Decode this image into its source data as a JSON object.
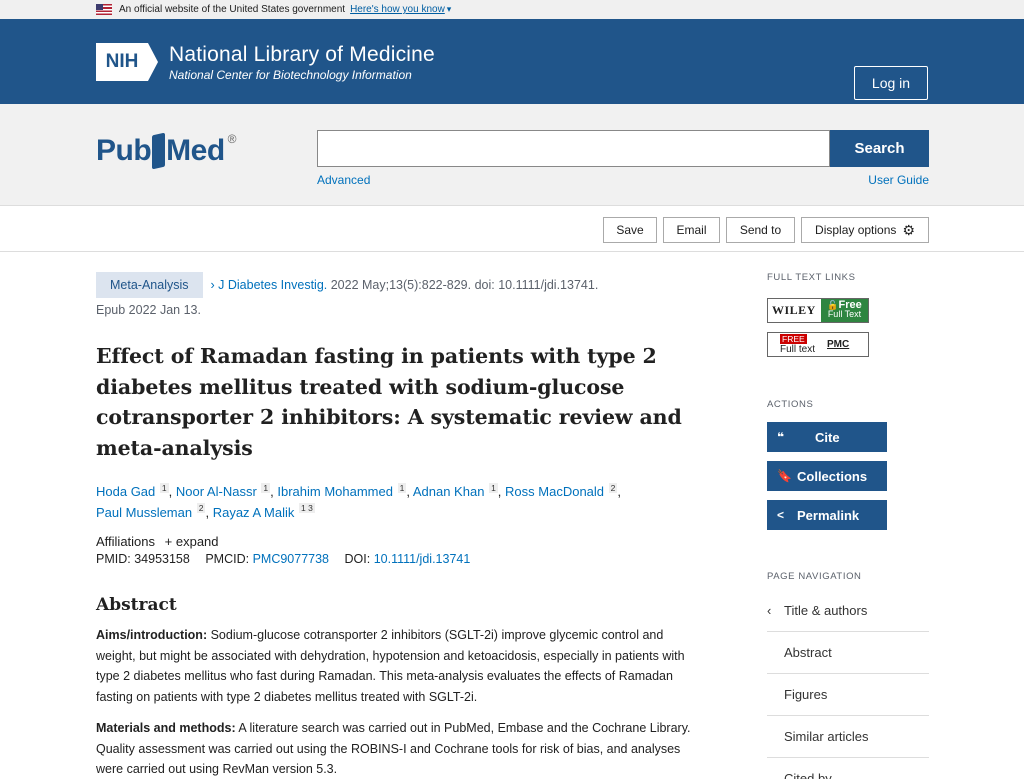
{
  "gov_banner": {
    "text": "An official website of the United States government",
    "link": "Here's how you know"
  },
  "header": {
    "logo": "NIH",
    "title": "National Library of Medicine",
    "subtitle": "National Center for Biotechnology Information",
    "login_label": "Log in"
  },
  "search": {
    "logo_pub": "Pub",
    "logo_med": "Med",
    "logo_reg": "®",
    "placeholder": "",
    "button_label": "Search",
    "advanced_label": "Advanced",
    "user_guide_label": "User Guide"
  },
  "toolbar": {
    "save_label": "Save",
    "email_label": "Email",
    "send_to_label": "Send to",
    "display_options_label": "Display options"
  },
  "article": {
    "type_badge": "Meta-Analysis",
    "journal": "J Diabetes Investig.",
    "citation": "2022 May;13(5):822-829. doi: 10.1111/jdi.13741.",
    "epub": "Epub 2022 Jan 13.",
    "title": "Effect of Ramadan fasting in patients with type 2 diabetes mellitus treated with sodium-glucose cotransporter 2 inhibitors: A systematic review and meta-analysis",
    "authors": [
      {
        "name": "Hoda Gad",
        "aff": "1"
      },
      {
        "name": "Noor Al-Nassr",
        "aff": "1"
      },
      {
        "name": "Ibrahim Mohammed",
        "aff": "1"
      },
      {
        "name": "Adnan Khan",
        "aff": "1"
      },
      {
        "name": "Ross MacDonald",
        "aff": "2"
      },
      {
        "name": "Paul Mussleman",
        "aff": "2"
      },
      {
        "name": "Rayaz A Malik",
        "aff": "1 3"
      }
    ],
    "affiliations_label": "Affiliations",
    "expand_label": "expand",
    "pmid_label": "PMID:",
    "pmid": "34953158",
    "pmcid_label": "PMCID:",
    "pmcid": "PMC9077738",
    "doi_label": "DOI:",
    "doi": "10.1111/jdi.13741"
  },
  "abstract": {
    "heading": "Abstract",
    "sections": [
      {
        "label": "Aims/introduction:",
        "text": " Sodium-glucose cotransporter 2 inhibitors (SGLT-2i) improve glycemic control and weight, but might be associated with dehydration, hypotension and ketoacidosis, especially in patients with type 2 diabetes mellitus who fast during Ramadan. This meta-analysis evaluates the effects of Ramadan fasting on patients with type 2 diabetes mellitus treated with SGLT-2i."
      },
      {
        "label": "Materials and methods:",
        "text": " A literature search was carried out in PubMed, Embase and the Cochrane Library. Quality assessment was carried out using the ROBINS-I and Cochrane tools for risk of bias, and analyses were carried out using RevMan version 5.3."
      }
    ]
  },
  "sidebar": {
    "full_text_heading": "FULL TEXT LINKS",
    "wiley_label": "WILEY",
    "wiley_free": "Free",
    "wiley_full_text": "Full Text",
    "pmc_free": "FREE",
    "pmc_full_text": "Full text",
    "pmc_label": "PMC",
    "actions_heading": "ACTIONS",
    "cite_label": "Cite",
    "collections_label": "Collections",
    "permalink_label": "Permalink",
    "page_nav_heading": "PAGE NAVIGATION",
    "nav_items": [
      "Title & authors",
      "Abstract",
      "Figures",
      "Similar articles",
      "Cited by"
    ]
  }
}
